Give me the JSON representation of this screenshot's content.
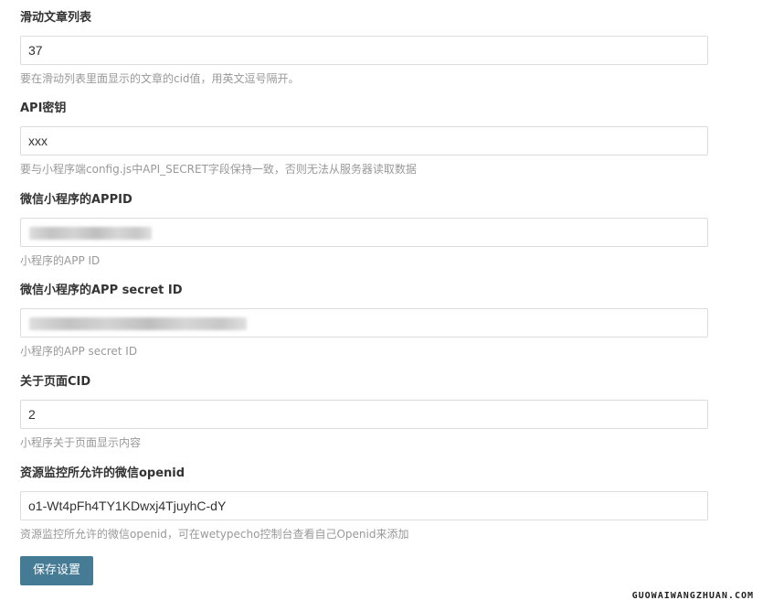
{
  "fields": [
    {
      "label": "滑动文章列表",
      "value": "37",
      "description": "要在滑动列表里面显示的文章的cid值，用英文逗号隔开。"
    },
    {
      "label": "API密钥",
      "value": "xxx",
      "description": "要与小程序端config.js中API_SECRET字段保持一致，否则无法从服务器读取数据"
    },
    {
      "label": "微信小程序的APPID",
      "value": "",
      "redacted": true,
      "description": "小程序的APP ID"
    },
    {
      "label": "微信小程序的APP secret ID",
      "value": "",
      "redacted": true,
      "description": "小程序的APP secret ID"
    },
    {
      "label": "关于页面CID",
      "value": "2",
      "description": "小程序关于页面显示内容"
    },
    {
      "label": "资源监控所允许的微信openid",
      "value": "o1-Wt4pFh4TY1KDwxj4TjuyhC-dY",
      "description": "资源监控所允许的微信openid，可在wetypecho控制台查看自己Openid来添加"
    }
  ],
  "save_button": {
    "label": "保存设置"
  },
  "watermark": "GUOWAIWANGZHUAN.COM",
  "colors": {
    "button_bg": "#467b96",
    "label_text": "#333333",
    "description_text": "#999999",
    "input_border": "#dcdcdc"
  }
}
